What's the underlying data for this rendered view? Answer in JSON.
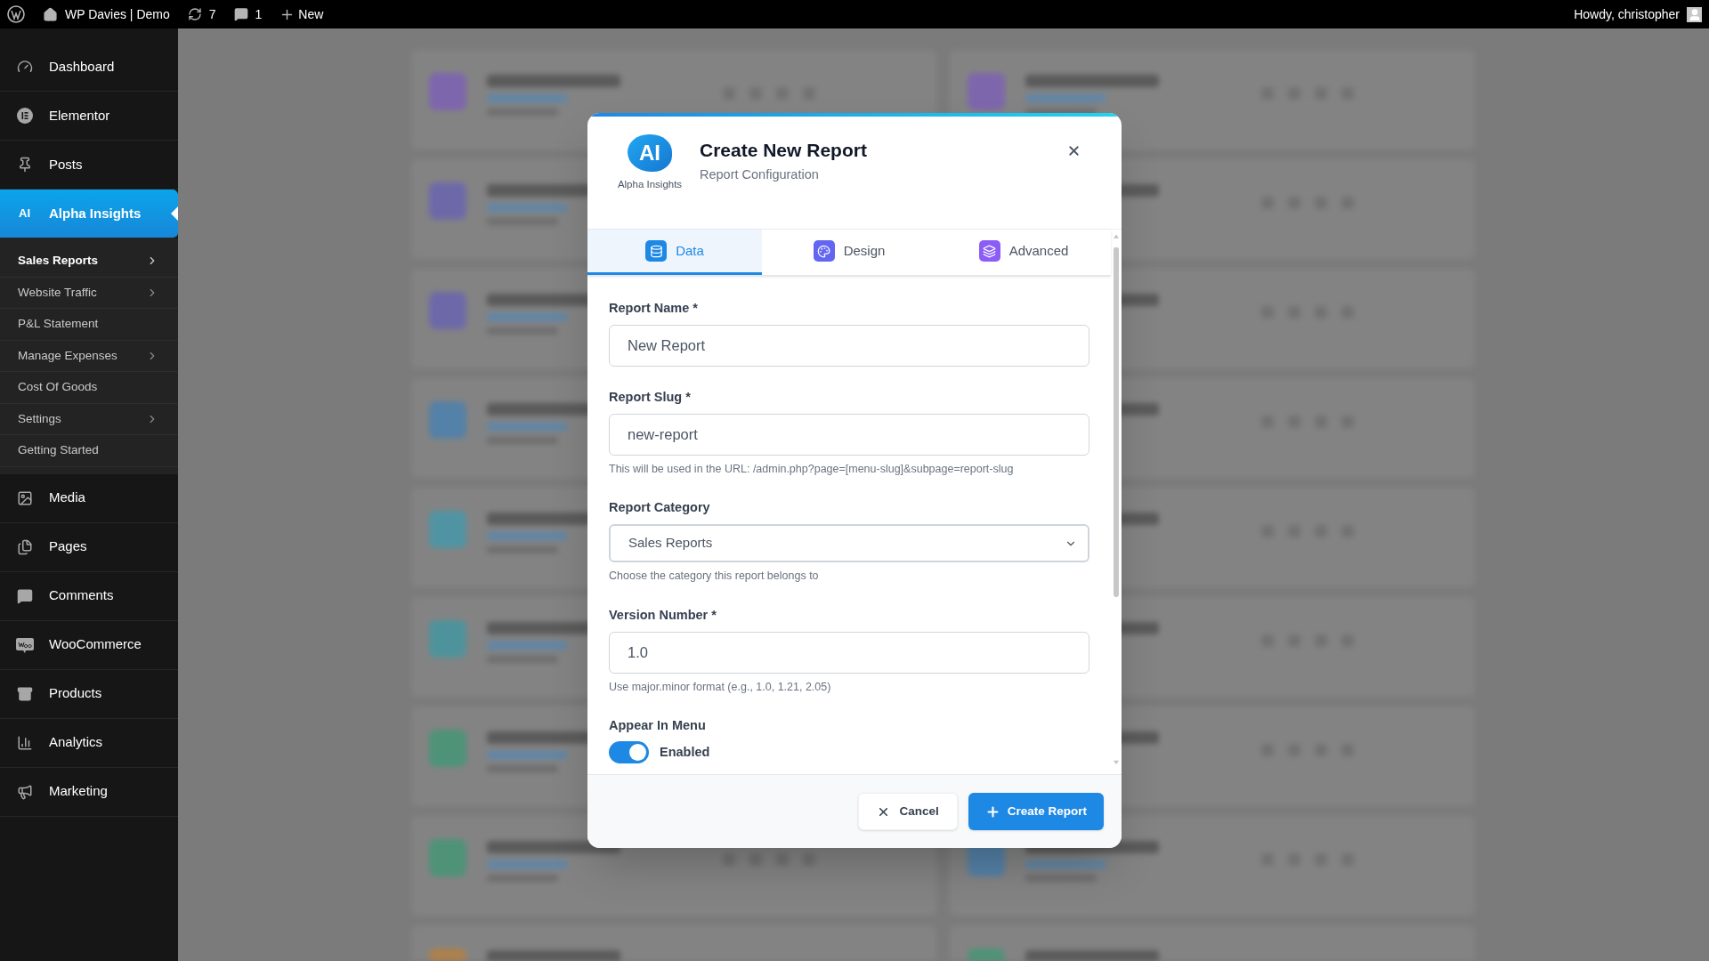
{
  "admin_bar": {
    "site": "WP Davies | Demo",
    "updates": "7",
    "comments": "1",
    "new": "New",
    "greeting": "Howdy, christopher"
  },
  "sidebar": {
    "items_before": [
      {
        "label": "Dashboard",
        "selected": false
      },
      {
        "label": "Elementor",
        "selected": false
      },
      {
        "label": "Posts",
        "selected": false
      },
      {
        "label": "Alpha Insights",
        "badge": "AI",
        "selected": true
      }
    ],
    "submenu": [
      {
        "label": "Sales Reports",
        "selected": true,
        "has_children": true
      },
      {
        "label": "Website Traffic",
        "selected": false,
        "has_children": true
      },
      {
        "label": "P&L Statement",
        "selected": false,
        "has_children": false
      },
      {
        "label": "Manage Expenses",
        "selected": false,
        "has_children": true
      },
      {
        "label": "Cost Of Goods",
        "selected": false,
        "has_children": false
      },
      {
        "label": "Settings",
        "selected": false,
        "has_children": true
      },
      {
        "label": "Getting Started",
        "selected": false,
        "has_children": false
      }
    ],
    "items_after": [
      {
        "label": "Media",
        "selected": false
      },
      {
        "label": "Pages",
        "selected": false
      },
      {
        "label": "Comments",
        "selected": false
      },
      {
        "label": "WooCommerce",
        "selected": false
      },
      {
        "label": "Products",
        "selected": false
      },
      {
        "label": "Analytics",
        "selected": false
      },
      {
        "label": "Marketing",
        "selected": false
      }
    ]
  },
  "modal": {
    "logo_text": "AI",
    "brand": "Alpha Insights",
    "title": "Create New Report",
    "subtitle": "Report Configuration",
    "tabs": [
      {
        "label": "Data",
        "selected": true
      },
      {
        "label": "Design",
        "selected": false
      },
      {
        "label": "Advanced",
        "selected": false
      }
    ],
    "fields": [
      {
        "kind": "text",
        "label": "Report Name *",
        "value": "New Report"
      },
      {
        "kind": "text",
        "label": "Report Slug *",
        "value": "new-report",
        "help": "This will be used in the URL: /admin.php?page=[menu-slug]&subpage=report-slug"
      },
      {
        "kind": "select",
        "label": "Report Category",
        "value": "Sales Reports",
        "help": "Choose the category this report belongs to"
      },
      {
        "kind": "text",
        "label": "Version Number *",
        "value": "1.0",
        "help": "Use major.minor format (e.g., 1.0, 1.21, 2.05)"
      },
      {
        "kind": "toggle",
        "label": "Appear In Menu",
        "on": true,
        "toggle_label": "Enabled"
      }
    ],
    "buttons": [
      {
        "kind": "secondary",
        "label": "Cancel"
      },
      {
        "kind": "primary",
        "label": "Create Report"
      }
    ]
  }
}
